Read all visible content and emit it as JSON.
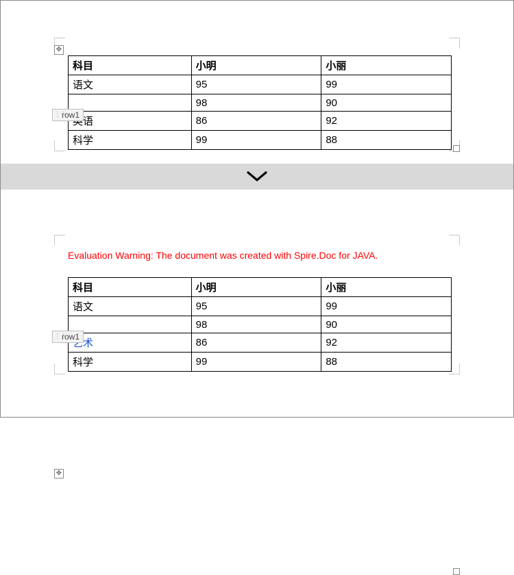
{
  "separator": {
    "icon": "chevron-down"
  },
  "warning_text": "Evaluation Warning: The document was created with Spire.Doc for JAVA.",
  "row_tag_label": "row1",
  "move_handle_glyph": "✥",
  "table1": {
    "headers": {
      "c1": "科目",
      "c2": "小明",
      "c3": "小丽"
    },
    "rows": [
      {
        "c1": "语文",
        "c2": "95",
        "c3": "99"
      },
      {
        "c1": "",
        "c2": "98",
        "c3": "90"
      },
      {
        "c1": "英语",
        "c2": "86",
        "c3": "92"
      },
      {
        "c1": "科学",
        "c2": "99",
        "c3": "88"
      }
    ]
  },
  "table2": {
    "headers": {
      "c1": "科目",
      "c2": "小明",
      "c3": "小丽"
    },
    "rows": [
      {
        "c1": "语文",
        "c2": "95",
        "c3": "99"
      },
      {
        "c1": "",
        "c2": "98",
        "c3": "90"
      },
      {
        "c1": "艺术",
        "c2": "86",
        "c3": "92"
      },
      {
        "c1": "科学",
        "c2": "99",
        "c3": "88"
      }
    ]
  }
}
